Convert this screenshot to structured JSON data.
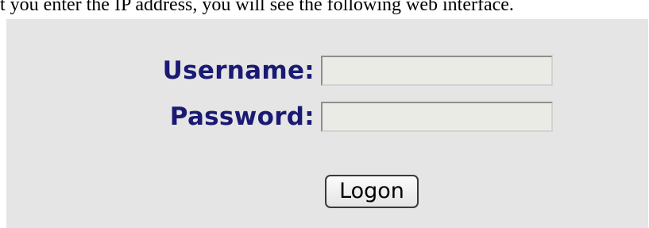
{
  "document": {
    "intro_text": "t you enter the IP address, you will see the following web interface."
  },
  "login": {
    "username_label": "Username:",
    "username_value": "",
    "password_label": "Password:",
    "password_value": "",
    "logon_label": "Logon"
  },
  "colors": {
    "panel_background": "#e5e5e5",
    "label_text": "#1a1a73",
    "field_background": "#ebebe6"
  }
}
